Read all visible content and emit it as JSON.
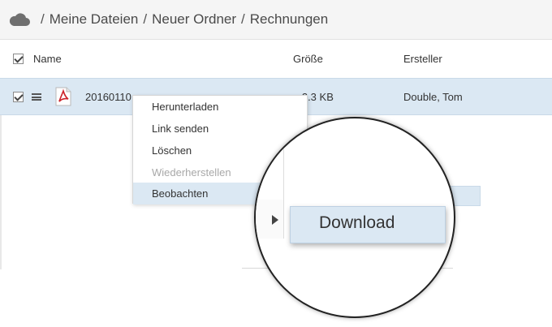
{
  "breadcrumb": {
    "icon": "cloud-icon",
    "items": [
      "Meine Dateien",
      "Neuer Ordner",
      "Rechnungen"
    ],
    "separator": "/"
  },
  "table": {
    "columns": {
      "name": "Name",
      "size": "Größe",
      "creator": "Ersteller"
    },
    "rows": [
      {
        "name": "20160110...",
        "name_tail": "...",
        "size": "...3.3 KB",
        "creator": "Double, Tom",
        "file_icon": "pdf-icon",
        "checked": true
      }
    ]
  },
  "context_menu": {
    "items": [
      {
        "label": "Herunterladen",
        "disabled": false,
        "active": false
      },
      {
        "label": "Link senden",
        "disabled": false,
        "active": false
      },
      {
        "label": "Löschen",
        "disabled": false,
        "active": false
      },
      {
        "label": "Wiederherstellen",
        "disabled": true,
        "active": false
      },
      {
        "label": "Beobachten",
        "disabled": false,
        "active": true
      }
    ]
  },
  "submenu_zoom": {
    "label": "Download",
    "arrow_icon": "caret-right-icon"
  },
  "colors": {
    "selection": "#dbe8f3",
    "breadcrumb_bg": "#f5f5f5",
    "disabled_text": "#a8a8a8",
    "pdf_red": "#cc2229"
  }
}
